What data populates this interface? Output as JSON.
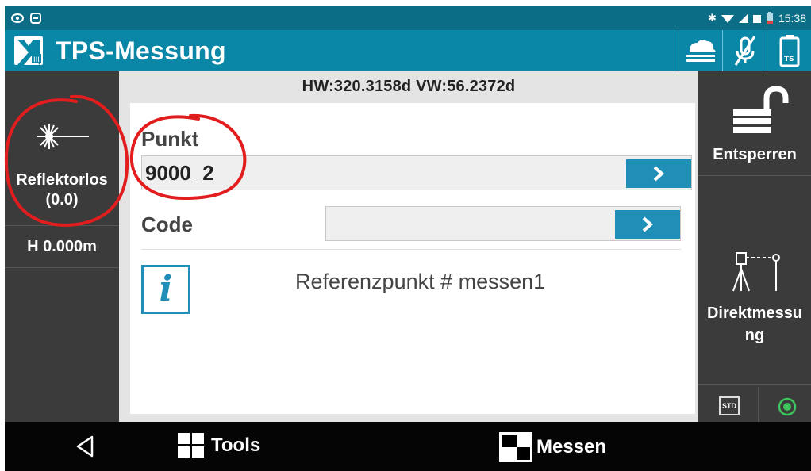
{
  "statusbar": {
    "time": "15:38",
    "icons": [
      "eye-icon",
      "link-icon",
      "bluetooth-icon",
      "wifi-icon",
      "signal-icon",
      "sim-icon",
      "battery-icon"
    ]
  },
  "appbar": {
    "title": "TPS-Messung",
    "icons": [
      "app-logo-icon",
      "fog-icon",
      "mic-off-icon",
      "tps-battery-icon"
    ]
  },
  "left_panel": {
    "reflector_label": "Reflektorlos",
    "reflector_value": "(0.0)",
    "height_label": "H 0.000m"
  },
  "header": {
    "angles": "HW:320.3158d  VW:56.2372d"
  },
  "form": {
    "punkt_label": "Punkt",
    "punkt_value": "9000_2",
    "code_label": "Code",
    "code_value": ""
  },
  "info": {
    "message": "Referenzpunkt # messen1"
  },
  "right_panel": {
    "unlock_label": "Entsperren",
    "direct_label_1": "Direktmessu",
    "direct_label_2": "ng",
    "std_label": "STD"
  },
  "navbar": {
    "tools_label": "Tools",
    "messen_label": "Messen"
  },
  "colors": {
    "accent": "#1f8fb8",
    "appbar": "#0a87a7",
    "statusbar": "#0b6e86",
    "panel": "#3b3b3b",
    "annotation": "#e11d1d"
  }
}
